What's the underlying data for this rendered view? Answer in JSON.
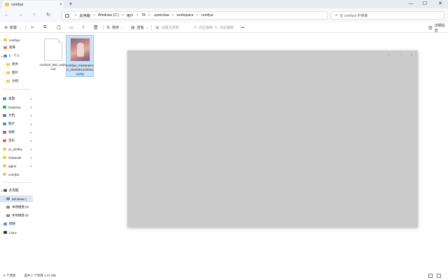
{
  "window": {
    "tab_label": "comfyui",
    "tab_close": "×",
    "new_tab": "+",
    "minimize": "—",
    "maximize": "☐",
    "close": "✕"
  },
  "nav": {
    "back": "←",
    "forward": "→",
    "up": "↑",
    "refresh": "↻",
    "breadcrumbs": [
      "此电脑",
      "Windows (C:)",
      "用户",
      "TK",
      ".openclaw",
      "workspace",
      "comfyui"
    ],
    "separator": ">",
    "search_placeholder": "在 comfyui 中搜索"
  },
  "toolbar": {
    "new_label": "新建",
    "sort_label": "排序",
    "view_label": "查看",
    "set_bg_label": "设置为背景",
    "rotate_left_label": "向左旋转",
    "rotate_right_label": "向右旋转",
    "more_label": "•••",
    "details_label": "详细信息",
    "icons": {
      "new": "⊕",
      "cut": "✂",
      "copy": "⧉",
      "paste": "📋",
      "rename": "▭",
      "share": "⇪",
      "delete": "🗑",
      "sort": "⇅",
      "view": "▤",
      "set_bg": "▣",
      "rotate_left": "↺",
      "rotate_right": "↻",
      "details": "▥"
    }
  },
  "sidebar": {
    "items": [
      {
        "label": "comfyui",
        "chev": "",
        "pin": "",
        "icon_color": "#f2c94c"
      },
      {
        "label": "图库",
        "chev": "",
        "pin": "",
        "icon_color": "#e07a5f"
      },
      {
        "label": "k - 个人",
        "chev": "▾",
        "pin": "",
        "icon_color": "#2f80ed"
      },
      {
        "label": "附件",
        "chev": "›",
        "pin": "",
        "icon_color": "#f2c94c"
      },
      {
        "label": "图片",
        "chev": "›",
        "pin": "",
        "icon_color": "#f2c94c"
      },
      {
        "label": "文档",
        "chev": "›",
        "pin": "",
        "icon_color": "#f2c94c"
      },
      {
        "label": "桌面",
        "chev": "",
        "pin": "✦",
        "icon_color": "#4a90d9"
      },
      {
        "label": "Downloa",
        "chev": "",
        "pin": "✦",
        "icon_color": "#27ae60"
      },
      {
        "label": "文档",
        "chev": "",
        "pin": "✦",
        "icon_color": "#6c7a89"
      },
      {
        "label": "图片",
        "chev": "",
        "pin": "✦",
        "icon_color": "#4a90d9"
      },
      {
        "label": "视频",
        "chev": "",
        "pin": "✦",
        "icon_color": "#9b51e0"
      },
      {
        "label": "音乐",
        "chev": "",
        "pin": "✦",
        "icon_color": "#eb5757"
      },
      {
        "label": "AI_Girlfrie",
        "chev": "",
        "pin": "✦",
        "icon_color": "#f2c94c"
      },
      {
        "label": "character",
        "chev": "",
        "pin": "✦",
        "icon_color": "#f2c94c"
      },
      {
        "label": "qqbot",
        "chev": "",
        "pin": "✦",
        "icon_color": "#f2c94c"
      },
      {
        "label": "comfyui",
        "chev": "",
        "pin": "",
        "icon_color": "#f2c94c"
      },
      {
        "label": "此电脑",
        "chev": "▾",
        "pin": "",
        "icon_color": "#4a5a6a"
      },
      {
        "label": "Windows (",
        "chev": "›",
        "pin": "",
        "icon_color": "#6c8ebf"
      },
      {
        "label": "本地磁盘 (D",
        "chev": "›",
        "pin": "",
        "icon_color": "#8a8a8a"
      },
      {
        "label": "本地磁盘 (E",
        "chev": "›",
        "pin": "",
        "icon_color": "#8a8a8a"
      },
      {
        "label": "网络",
        "chev": "›",
        "pin": "",
        "icon_color": "#4a90d9"
      },
      {
        "label": "Linux",
        "chev": "›",
        "pin": "",
        "icon_color": "#333333"
      }
    ]
  },
  "files": [
    {
      "name": "comfyui_last_output.txt",
      "type": "txt",
      "selected": false
    },
    {
      "name": "comfyui_masterpiece_20260612220344.png",
      "type": "png",
      "selected": true
    }
  ],
  "preview": {
    "minimize": "–",
    "maximize": "▫",
    "close": "×"
  },
  "status": {
    "count": "2 个项目",
    "selection": "选中 1 个项目  2.47 MB"
  },
  "colors": {
    "accent": "#0067c0",
    "selection_bg": "#cce4f7",
    "preview_bg": "#cbcbcb"
  }
}
